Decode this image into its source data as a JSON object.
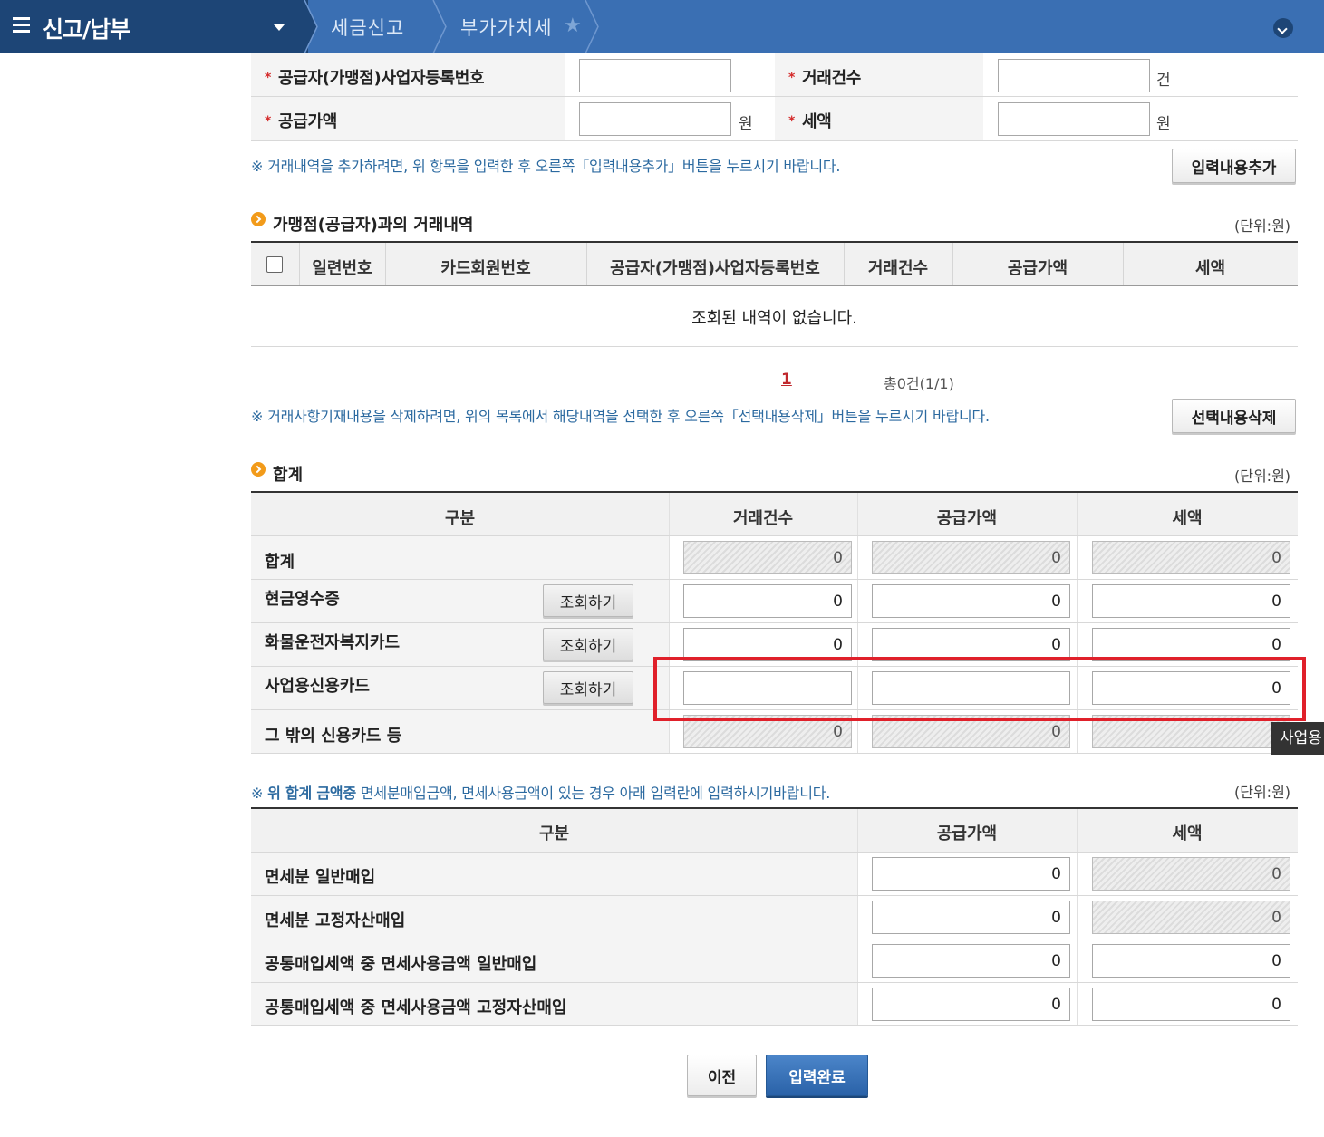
{
  "header": {
    "menu_title": "신고/납부",
    "breadcrumbs": [
      "세금신고",
      "부가가치세"
    ]
  },
  "entry_form": {
    "supplier_reg_no_label": "공급자(가맹점)사업자등록번호",
    "transaction_count_label": "거래건수",
    "transaction_count_unit": "건",
    "supply_amount_label": "공급가액",
    "supply_amount_unit": "원",
    "tax_label": "세액",
    "tax_unit": "원",
    "notice": "※ 거래내역을 추가하려면, 위 항목을 입력한 후 오른쪽「입력내용추가」버튼을 누르시기 바랍니다.",
    "add_button": "입력내용추가"
  },
  "transactions": {
    "title": "가맹점(공급자)과의 거래내역",
    "unit_note": "(단위:원)",
    "columns": [
      "일련번호",
      "카드회원번호",
      "공급자(가맹점)사업자등록번호",
      "거래건수",
      "공급가액",
      "세액"
    ],
    "empty_message": "조회된 내역이 없습니다.",
    "page": "1",
    "total": "총0건(1/1)",
    "delete_notice": "※ 거래사항기재내용을 삭제하려면, 위의 목록에서 해당내역을 선택한 후 오른쪽「선택내용삭제」버튼을 누르시기 바랍니다.",
    "delete_button": "선택내용삭제"
  },
  "totals": {
    "title": "합계",
    "unit_note": "(단위:원)",
    "columns": [
      "구분",
      "거래건수",
      "공급가액",
      "세액"
    ],
    "lookup_label": "조회하기",
    "rows": [
      {
        "label": "합계",
        "count": "0",
        "supply": "0",
        "tax": "0"
      },
      {
        "label": "현금영수증",
        "count": "0",
        "supply": "0",
        "tax": "0"
      },
      {
        "label": "화물운전자복지카드",
        "count": "0",
        "supply": "0",
        "tax": "0"
      },
      {
        "label": "사업용신용카드",
        "count": "",
        "supply": "",
        "tax": "0"
      },
      {
        "label": "그 밖의 신용카드 등",
        "count": "0",
        "supply": "0",
        "tax": ""
      }
    ],
    "tooltip": "사업용"
  },
  "exempt": {
    "notice_prefix": "※",
    "notice_bold": "위 합계 금액중",
    "notice_rest": "면세분매입금액, 면세사용금액이 있는 경우 아래 입력란에 입력하시기바랍니다.",
    "unit_note": "(단위:원)",
    "columns": [
      "구분",
      "공급가액",
      "세액"
    ],
    "rows": [
      {
        "label": "면세분 일반매입",
        "supply": "0",
        "tax": "0"
      },
      {
        "label": "면세분 고정자산매입",
        "supply": "0",
        "tax": "0"
      },
      {
        "label": "공통매입세액 중 면세사용금액 일반매입",
        "supply": "0",
        "tax": "0"
      },
      {
        "label": "공통매입세액 중 면세사용금액 고정자산매입",
        "supply": "0",
        "tax": "0"
      }
    ]
  },
  "footer": {
    "prev_button": "이전",
    "complete_button": "입력완료"
  },
  "colors": {
    "header_blue": "#3a6fb3",
    "menu_navy": "#1d4576",
    "primary_button": "#2a62a8",
    "highlight_red": "#e0202a",
    "bullet_orange": "#f29b1a"
  }
}
